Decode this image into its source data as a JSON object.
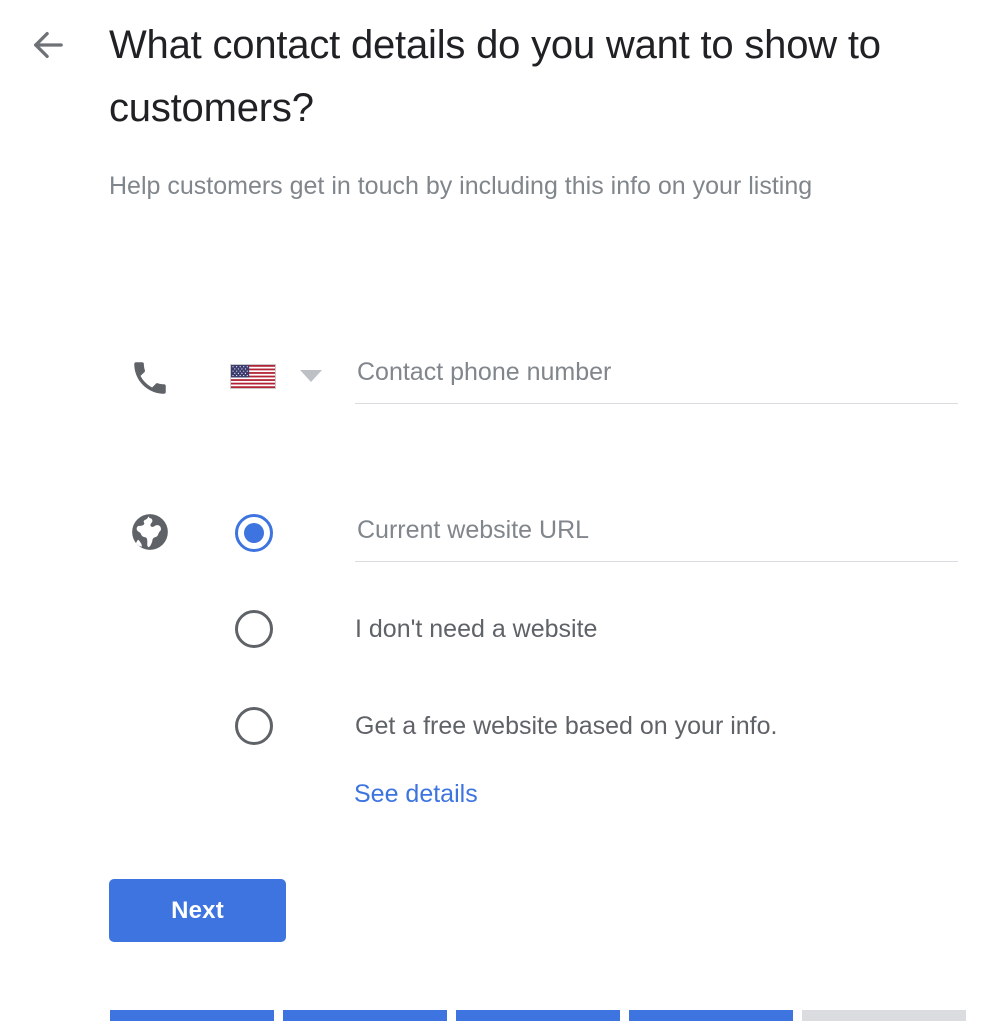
{
  "header": {
    "back_icon": "arrow-left-icon",
    "title": "What contact details do you want to show to customers?",
    "subtitle": "Help customers get in touch by including this info on your listing"
  },
  "phone_row": {
    "icon": "phone-icon",
    "country_flag": "us-flag-icon",
    "country_caret": "chevron-down-icon",
    "placeholder": "Contact phone number",
    "value": ""
  },
  "website_section": {
    "icon": "globe-icon",
    "options": [
      {
        "id": "current-website",
        "type": "input",
        "selected": true,
        "placeholder": "Current website URL",
        "value": ""
      },
      {
        "id": "no-website",
        "type": "label",
        "selected": false,
        "label": "I don't need a website"
      },
      {
        "id": "free-website",
        "type": "label",
        "selected": false,
        "label": "Get a free website based on your info.",
        "link_label": "See details"
      }
    ]
  },
  "actions": {
    "next_label": "Next"
  },
  "progress": {
    "total_steps": 5,
    "completed_steps": 4
  },
  "colors": {
    "accent": "#3d74e0",
    "title_text": "#202124",
    "muted_text": "#80868b",
    "label_text": "#5f6368",
    "track": "#dadce0"
  }
}
